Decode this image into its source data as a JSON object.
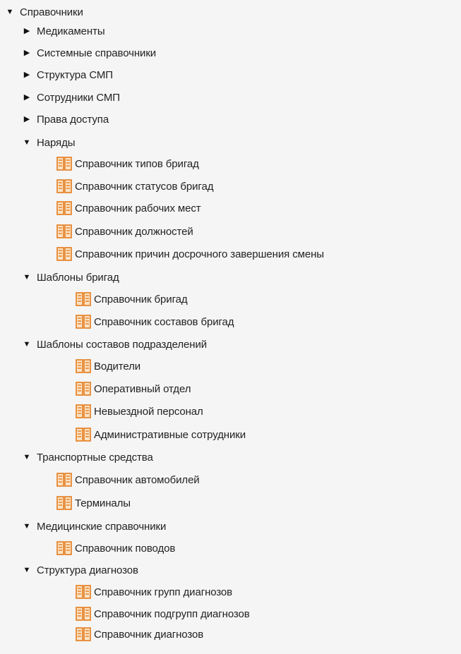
{
  "icons": {
    "expanded": "caret-down-icon",
    "collapsed": "caret-right-icon",
    "leaf": "reference-book-icon"
  },
  "colors": {
    "icon_orange": "#e47b1c",
    "icon_fill": "#fbe3c6",
    "text": "#222222",
    "background": "#f5f5f5"
  },
  "tree": [
    {
      "label": "Справочники",
      "type": "expanded",
      "depth": 0
    },
    {
      "label": "Медикаменты",
      "type": "collapsed",
      "depth": 1
    },
    {
      "label": "Системные справочники",
      "type": "collapsed",
      "depth": 1
    },
    {
      "label": "Структура СМП",
      "type": "collapsed",
      "depth": 1
    },
    {
      "label": "Сотрудники СМП",
      "type": "collapsed",
      "depth": 1
    },
    {
      "label": "Права доступа",
      "type": "collapsed",
      "depth": 1
    },
    {
      "label": "Наряды",
      "type": "expanded",
      "depth": 1
    },
    {
      "label": "Справочник типов бригад",
      "type": "leaf",
      "depth": 2
    },
    {
      "label": "Справочник статусов бригад",
      "type": "leaf",
      "depth": 2
    },
    {
      "label": "Справочник рабочих мест",
      "type": "leaf",
      "depth": 2
    },
    {
      "label": "Справочник должностей",
      "type": "leaf",
      "depth": 2
    },
    {
      "label": "Справочник причин досрочного завершения смены",
      "type": "leaf",
      "depth": 2
    },
    {
      "label": "Шаблоны бригад",
      "type": "expanded",
      "depth": 2
    },
    {
      "label": "Справочник бригад",
      "type": "leaf",
      "depth": 3
    },
    {
      "label": "Справочник составов бригад",
      "type": "leaf",
      "depth": 3
    },
    {
      "label": "Шаблоны составов подразделений",
      "type": "expanded",
      "depth": 2
    },
    {
      "label": "Водители",
      "type": "leaf",
      "depth": 3
    },
    {
      "label": "Оперативный отдел",
      "type": "leaf",
      "depth": 3
    },
    {
      "label": "Невыездной персонал",
      "type": "leaf",
      "depth": 3
    },
    {
      "label": "Административные сотрудники",
      "type": "leaf",
      "depth": 3
    },
    {
      "label": "Транспортные средства",
      "type": "expanded",
      "depth": 1
    },
    {
      "label": "Справочник автомобилей",
      "type": "leaf",
      "depth": 2
    },
    {
      "label": "Терминалы",
      "type": "leaf",
      "depth": 2
    },
    {
      "label": "Медицинские справочники",
      "type": "expanded",
      "depth": 1
    },
    {
      "label": "Справочник поводов",
      "type": "leaf",
      "depth": 2
    },
    {
      "label": "Структура диагнозов",
      "type": "expanded",
      "depth": 2
    },
    {
      "label": "Справочник групп диагнозов",
      "type": "leaf",
      "depth": 3
    },
    {
      "label": "Справочник подгрупп диагнозов",
      "type": "leaf",
      "depth": 3
    },
    {
      "label": "Справочник диагнозов",
      "type": "leaf",
      "depth": 3
    }
  ]
}
